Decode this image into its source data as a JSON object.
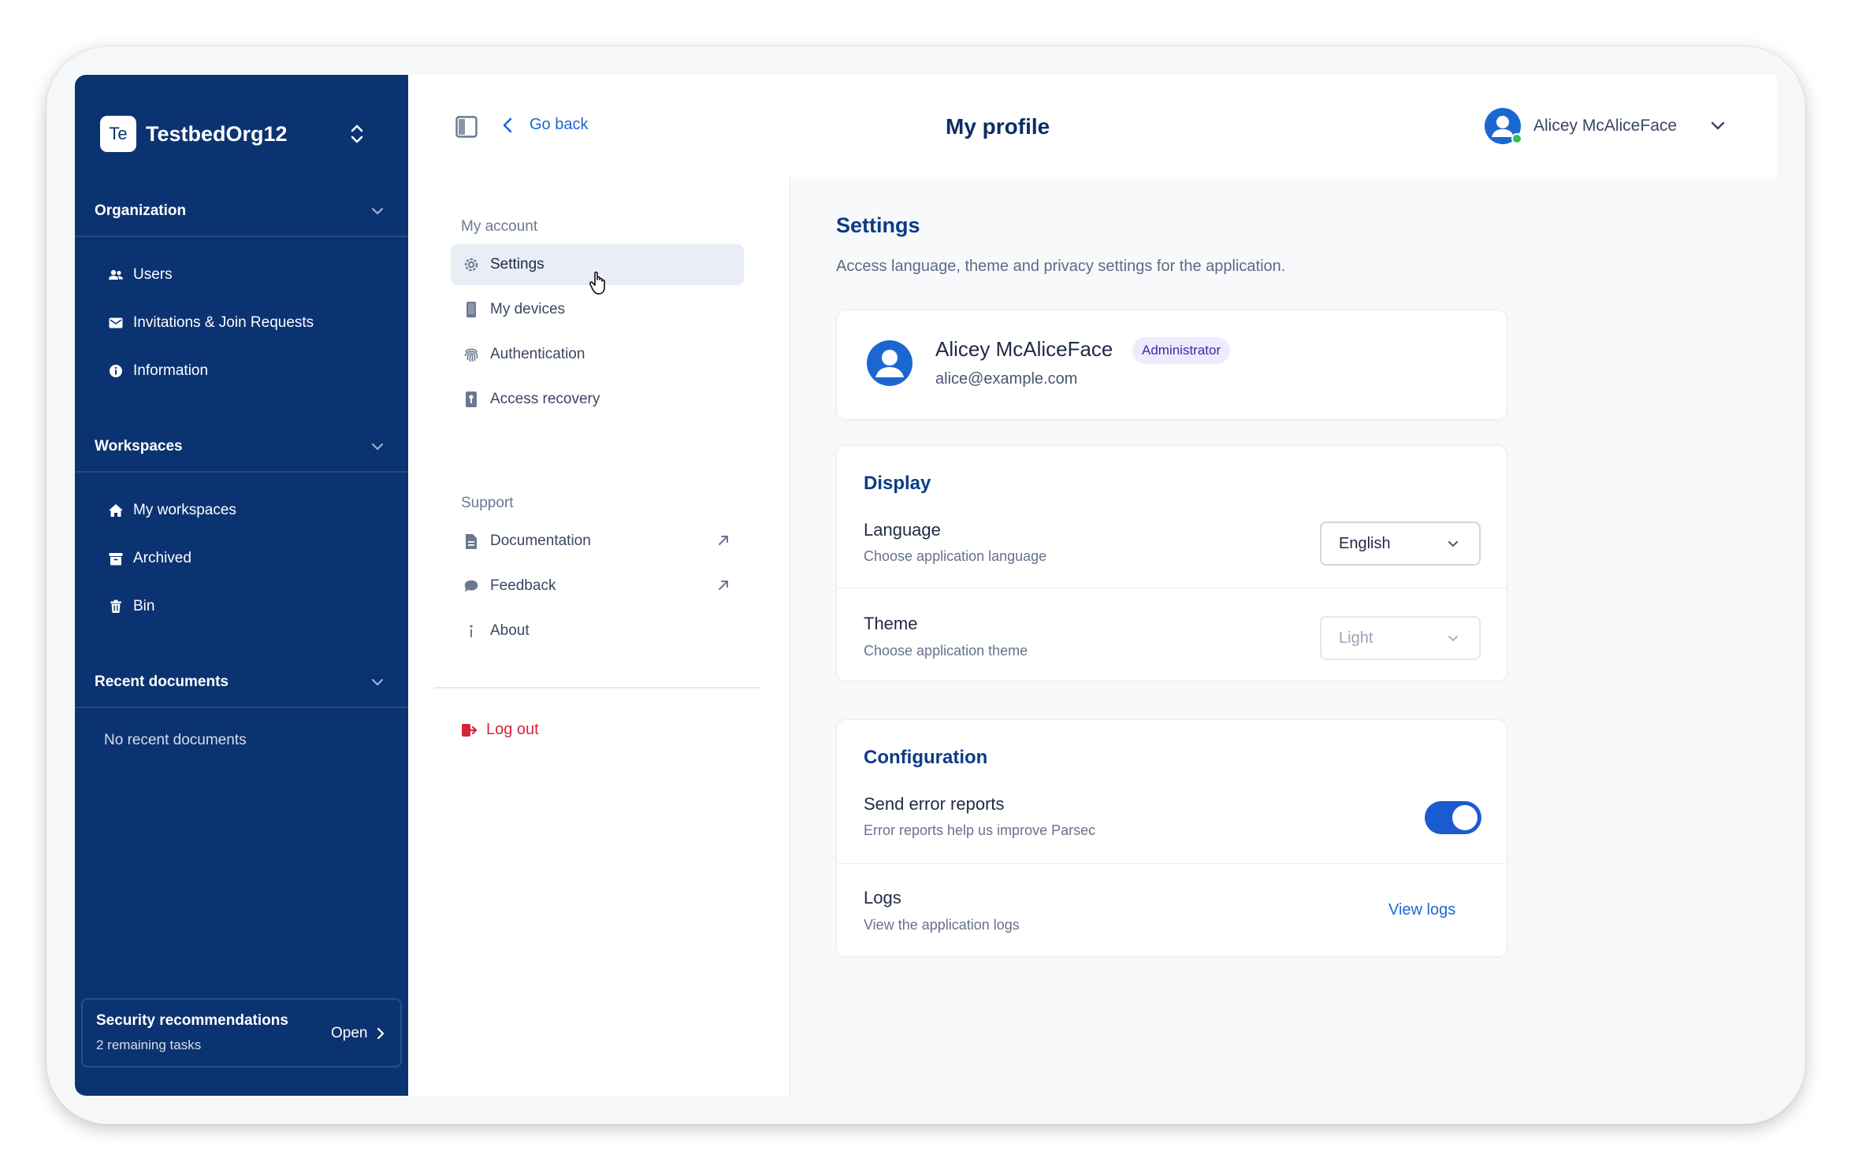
{
  "sidebar": {
    "org_initials": "Te",
    "org_name": "TestbedOrg12",
    "sections": {
      "organization": {
        "title": "Organization",
        "items": [
          {
            "label": "Users",
            "icon": "users-icon"
          },
          {
            "label": "Invitations & Join Requests",
            "icon": "mail-icon"
          },
          {
            "label": "Information",
            "icon": "info-icon"
          }
        ]
      },
      "workspaces": {
        "title": "Workspaces",
        "items": [
          {
            "label": "My workspaces",
            "icon": "home-icon"
          },
          {
            "label": "Archived",
            "icon": "archive-icon"
          },
          {
            "label": "Bin",
            "icon": "trash-icon"
          }
        ]
      },
      "recent": {
        "title": "Recent documents",
        "empty": "No recent documents"
      }
    },
    "security": {
      "title": "Security recommendations",
      "subtitle": "2 remaining tasks",
      "action": "Open"
    }
  },
  "topbar": {
    "back_label": "Go back",
    "title": "My profile",
    "user_name": "Alicey McAliceFace"
  },
  "account_menu": {
    "my_account_label": "My account",
    "my_account_items": [
      {
        "label": "Settings",
        "icon": "gear-icon",
        "active": true
      },
      {
        "label": "My devices",
        "icon": "device-icon"
      },
      {
        "label": "Authentication",
        "icon": "fingerprint-icon"
      },
      {
        "label": "Access recovery",
        "icon": "recovery-icon"
      }
    ],
    "support_label": "Support",
    "support_items": [
      {
        "label": "Documentation",
        "icon": "document-icon",
        "external": true
      },
      {
        "label": "Feedback",
        "icon": "chat-icon",
        "external": true
      },
      {
        "label": "About",
        "icon": "info-icon"
      }
    ],
    "logout_label": "Log out"
  },
  "settings": {
    "title": "Settings",
    "subtitle": "Access language, theme and privacy settings for the application.",
    "profile": {
      "name": "Alicey McAliceFace",
      "role": "Administrator",
      "email": "alice@example.com"
    },
    "display": {
      "title": "Display",
      "language": {
        "title": "Language",
        "subtitle": "Choose application language",
        "value": "English"
      },
      "theme": {
        "title": "Theme",
        "subtitle": "Choose application theme",
        "value": "Light"
      }
    },
    "configuration": {
      "title": "Configuration",
      "error_reports": {
        "title": "Send error reports",
        "subtitle": "Error reports help us improve Parsec",
        "enabled": true
      },
      "logs": {
        "title": "Logs",
        "subtitle": "View the application logs",
        "action": "View logs"
      }
    }
  },
  "colors": {
    "sidebar_bg": "#0c3371",
    "accent": "#1a67d2",
    "danger": "#d8243b",
    "online": "#2bbd63"
  }
}
